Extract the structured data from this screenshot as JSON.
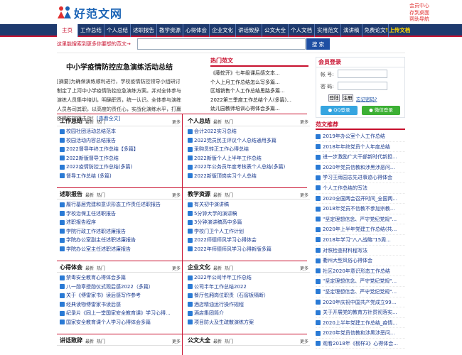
{
  "header": {
    "logo_text": "好范文网",
    "top_links": [
      "会员中心",
      "存到桌面",
      "帮助导航"
    ]
  },
  "nav": {
    "items": [
      "主页",
      "工作总结",
      "个人总结",
      "述职报告",
      "教学资源",
      "心得体会",
      "企业文化",
      "讲话致辞",
      "公文大全",
      "个人文档",
      "实用范文",
      "演讲稿",
      "免费论文"
    ],
    "upload": "↑上传文档"
  },
  "search": {
    "tip": "这里能搜索到更多你要想的范文→",
    "placeholder": "",
    "button": "搜 索"
  },
  "featured": {
    "title": "中小学疫情防控应急演练活动总结",
    "body": "[摘要]为确保演练顺利进行，学校疫情防控领导小组研讨制定了上河中小学疫情防控应急演练方案。并对全体参与演练人员集中培训，明确职责，统一认识。全体参与演练人员各司其职，以高度的责任心，实战化演练水平，打赢疫情防控阻击战！",
    "more": "[查看全文]"
  },
  "hot": {
    "title": "热门范文",
    "items": [
      "《藤蛇开》七年级课后感文本...",
      "个人上月工作总结怎么写多篇...",
      "区城销售个人工作总结思路多篇...",
      "2022第三季度工作总结个人(多篇)...",
      "幼儿园教师培训心得体会多篇..."
    ]
  },
  "login": {
    "title": "会员登录",
    "account_label": "帐 号:",
    "password_label": "密 码:",
    "login_button": "登陆",
    "register_button": "注册",
    "forgot": "忘记密码?",
    "qq_button": "QQ登录",
    "wechat_button": "微信登录"
  },
  "sections": [
    {
      "title": "工作总结",
      "items": [
        "校园社团活动总结范本",
        "校园活动内容总结报告",
        "2022督导年终工作总结【多篇】",
        "2022新版督导工作总结",
        "2022疫情防控工作总结(多篇)",
        "督导工作总结 (多篇)"
      ]
    },
    {
      "title": "个人总结",
      "items": [
        "会计2022实习总结",
        "2022党员民主评议个人总结通用多篇",
        "采购员转正工作心得总结",
        "2022新版个人上半年工作总结",
        "2022年公务员年度考核表个人总结(多篇)",
        "2022新版顶岗实习个人总结"
      ]
    },
    {
      "title": "述职报告",
      "items": [
        "履行基层党建和意识形态工作责任述职报告",
        "学校治保主任述职报告",
        "述职报告程序",
        "学院行政工作述职述廉报告",
        "学院办公室副主任述职述廉报告",
        "学院办公室主任述职述廉报告"
      ]
    },
    {
      "title": "教学资源",
      "items": [
        "有关初中演讲稿",
        "5分钟大学的演讲稿",
        "3分钟演讲稿高中多篇",
        "学校门卫个人工作计划",
        "2022师德师风学习心得体会",
        "2022年师德师风学习心得新版多篇"
      ]
    },
    {
      "title": "心得体会",
      "items": [
        "禁毒安全教育心得体会多篇",
        "八一勋章授勋仪式观后感2022（多篇）",
        "关于《傅雷家书》读后感写作参考",
        "经典读物傅雷家书读后感",
        "纪录片《同上一堂国家安全教育课》学习心得...",
        "国家安全教育课个人学习心得体会多篇"
      ]
    },
    {
      "title": "企业文化",
      "items": [
        "2022年公司半年工作总结",
        "公司半年工作总结2022",
        "餐厅包厢岗位职责（石窖板隔断）",
        "酒店精油运行操作规程",
        "酒店集团简介",
        "项目防火及生疏散演练方案"
      ]
    },
    {
      "title": "讲话致辞",
      "items": []
    },
    {
      "title": "公文大全",
      "items": []
    }
  ],
  "section_labels": {
    "newest": "最新",
    "hot": "热门",
    "more": "更多"
  },
  "recommend": {
    "title": "范文推荐",
    "items": [
      "2019年办公室个人工作总结",
      "2018年年终党员个人年度总结",
      "进一步激励广大干部新时代新担...",
      "2020年党员信教和涉黑涉恶问...",
      "学习王雨园志先进事迹心得体会",
      "个人工作总结的写法",
      "2020全国两会召开时间_全国两...",
      "2018年党员不信教不参加宗教...",
      "\"坚定理想信念、严守党纪党规\"...",
      "2020年上半年党建工作总结(共...",
      "2018年学习\"八八战略\"15周...",
      "对照检查材料程写法",
      "衢州大型风俗心得体会",
      "社区2020年意识形态工作总结",
      "\"坚定理想信念、严守党纪党规\"...",
      "\"坚定理想信念、严守党纪党规\"...",
      "2020年庆祝中国共产党成立99...",
      "关于开展党的教育方针贯彻落实...",
      "2020上半年党建工作总结_疫情...",
      "2020年党员信教和涉黑涉恶问...",
      "观看2018年《榜样3》心得体会..."
    ]
  }
}
